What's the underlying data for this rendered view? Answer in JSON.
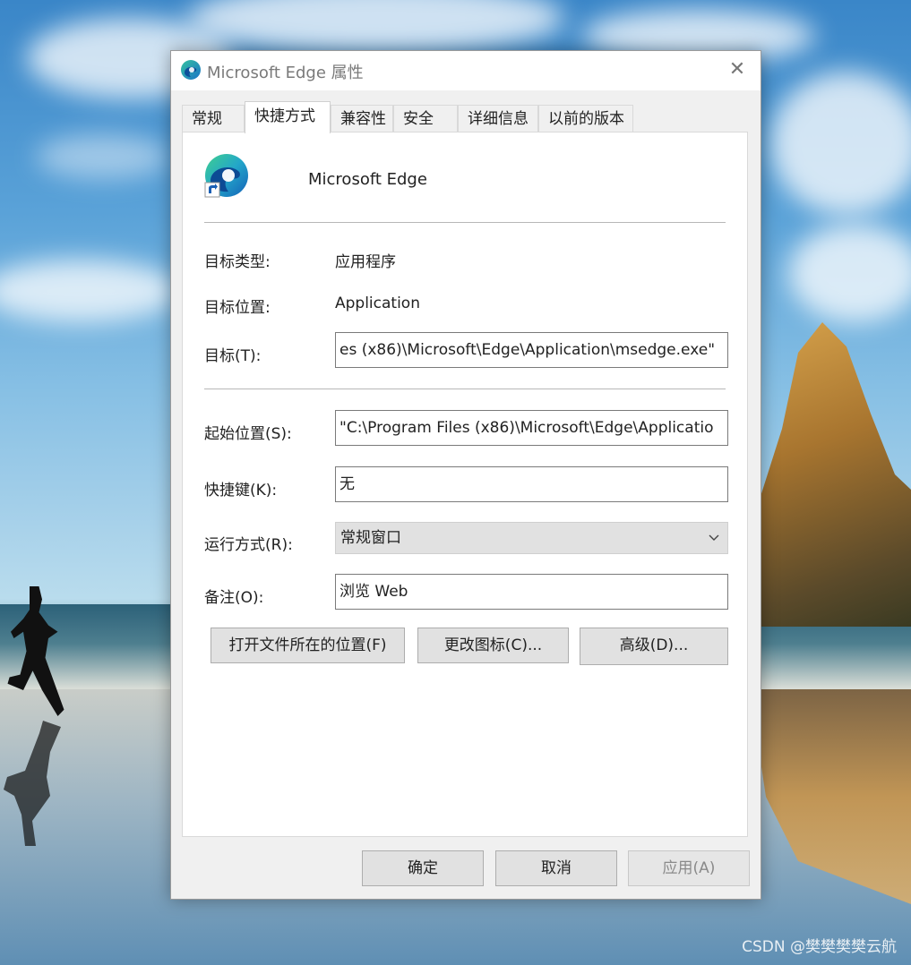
{
  "window": {
    "title": "Microsoft Edge 属性",
    "close_glyph": "✕"
  },
  "tabs": [
    {
      "label": "常规"
    },
    {
      "label": "快捷方式",
      "active": true
    },
    {
      "label": "兼容性"
    },
    {
      "label": "安全"
    },
    {
      "label": "详细信息"
    },
    {
      "label": "以前的版本"
    }
  ],
  "shortcut": {
    "app_name": "Microsoft Edge",
    "target_type_label": "目标类型:",
    "target_type_value": "应用程序",
    "target_location_label": "目标位置:",
    "target_location_value": "Application",
    "target_label": "目标(T):",
    "target_value": "es (x86)\\Microsoft\\Edge\\Application\\msedge.exe\"",
    "start_in_label": "起始位置(S):",
    "start_in_value": "\"C:\\Program Files (x86)\\Microsoft\\Edge\\Applicatio",
    "hotkey_label": "快捷键(K):",
    "hotkey_value": "无",
    "run_label": "运行方式(R):",
    "run_value": "常规窗口",
    "comment_label": "备注(O):",
    "comment_value": "浏览 Web",
    "open_location_button": "打开文件所在的位置(F)",
    "change_icon_button": "更改图标(C)...",
    "advanced_button": "高级(D)..."
  },
  "footer": {
    "ok": "确定",
    "cancel": "取消",
    "apply": "应用(A)"
  },
  "watermark": "CSDN @樊樊樊樊云航"
}
